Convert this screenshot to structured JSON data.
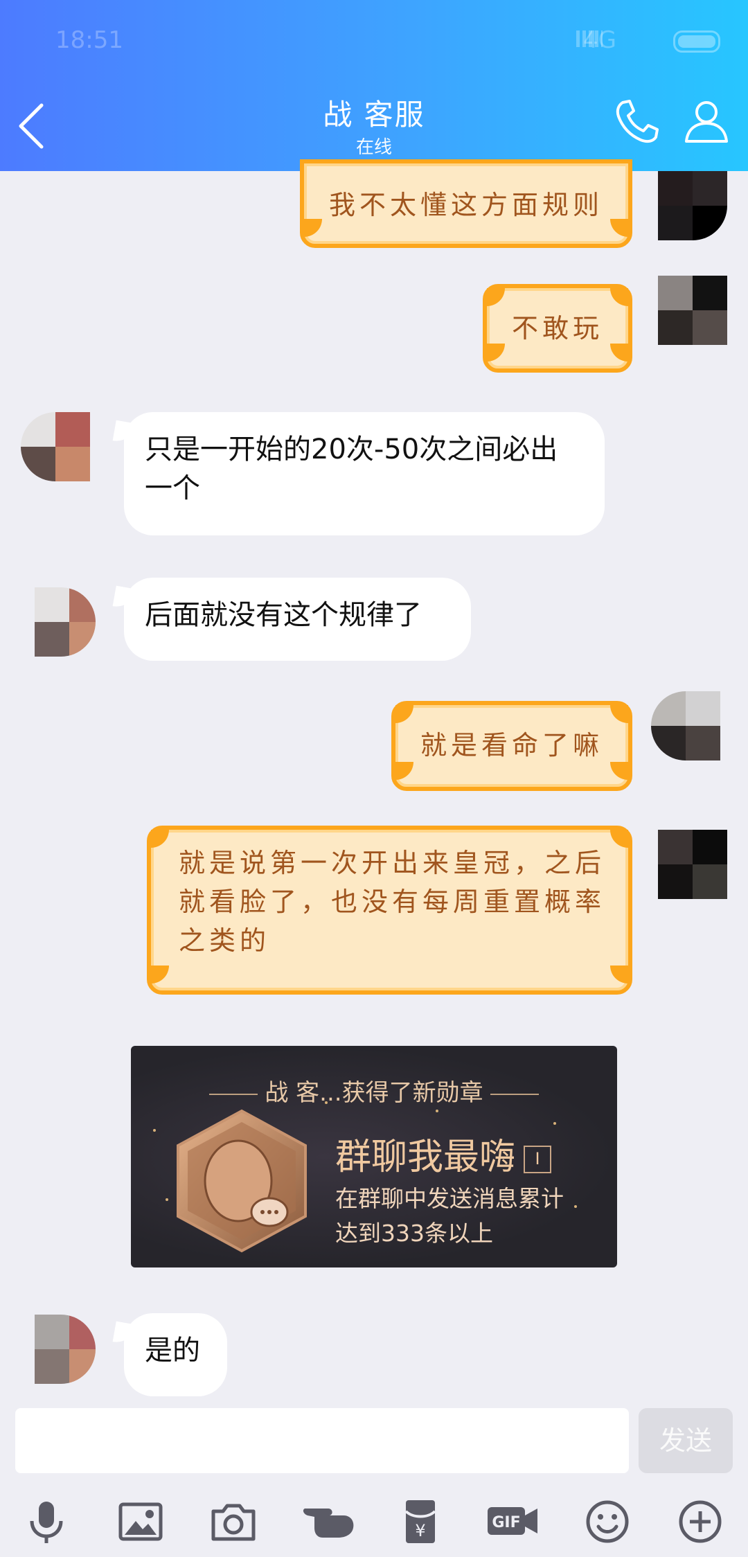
{
  "status": {
    "time": "18:51",
    "network": "4G"
  },
  "header": {
    "title": "战 客服",
    "subtitle": "在线"
  },
  "messages": [
    {
      "side": "right",
      "style": "orange",
      "text": "我不太懂这方面规则"
    },
    {
      "side": "right",
      "style": "orange",
      "text": "不敢玩"
    },
    {
      "side": "left",
      "style": "plain",
      "text": "只是一开始的20次-50次之间必出一个"
    },
    {
      "side": "left",
      "style": "plain",
      "text": "后面就没有这个规律了"
    },
    {
      "side": "right",
      "style": "orange",
      "text": "就是看命了嘛"
    },
    {
      "side": "right",
      "style": "orange",
      "text": "就是说第一次开出来皇冠，之后就看脸了，也没有每周重置概率之类的"
    },
    {
      "side": "left",
      "style": "plain",
      "text": "是的"
    }
  ],
  "badge": {
    "header": "战 客...获得了新勋章",
    "name": "群聊我最嗨",
    "level": "I",
    "description": "在群聊中发送消息累计达到333条以上"
  },
  "input": {
    "placeholder": "",
    "send_label": "发送"
  },
  "toolbar": [
    "microphone-icon",
    "image-icon",
    "camera-icon",
    "poke-icon",
    "red-packet-icon",
    "gif-icon",
    "emoji-icon",
    "plus-icon"
  ],
  "colors": {
    "header_start": "#4d7bff",
    "header_end": "#27c6ff",
    "bubble_orange_border": "#fca61c",
    "bubble_orange_fill": "#fde9c5",
    "bubble_orange_text": "#a0551e",
    "background": "#eeeef4"
  }
}
